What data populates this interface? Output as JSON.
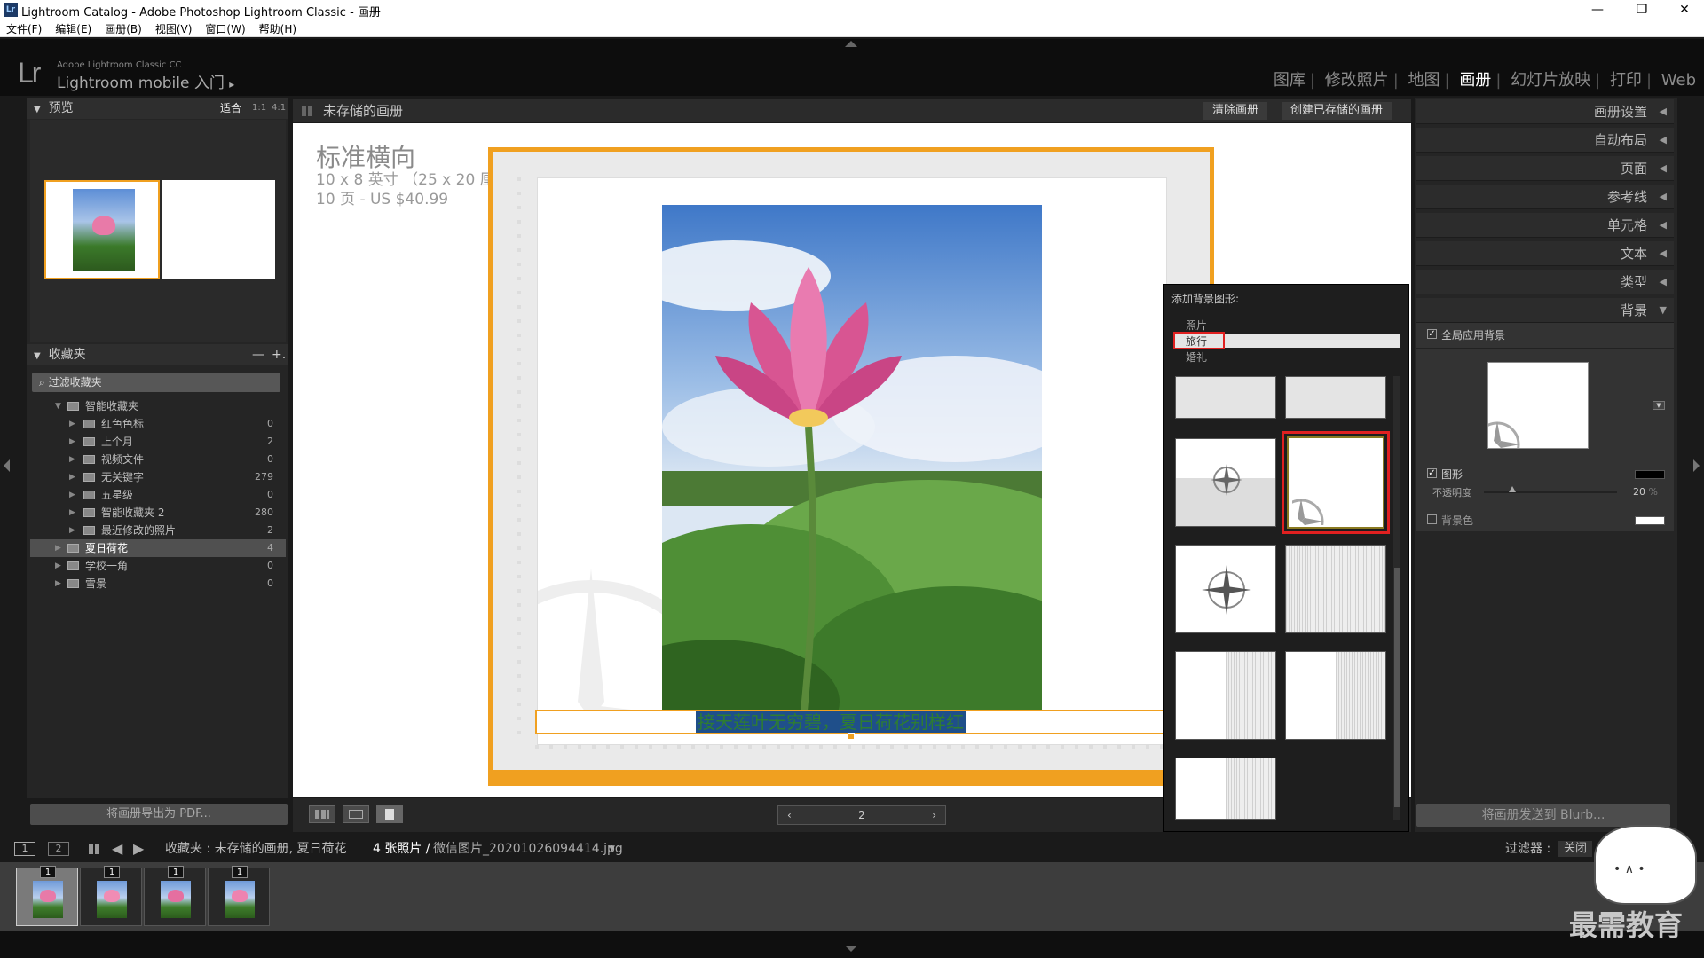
{
  "window": {
    "title": "Lightroom Catalog - Adobe Photoshop Lightroom Classic - 画册",
    "app_icon": "Lr",
    "minimize": "—",
    "restore": "❐",
    "close": "✕"
  },
  "menu": [
    "文件(F)",
    "编辑(E)",
    "画册(B)",
    "视图(V)",
    "窗口(W)",
    "帮助(H)"
  ],
  "identity": {
    "logo": "Lr",
    "small": "Adobe Lightroom Classic CC",
    "big": "Lightroom mobile 入门",
    "arrow": "▸"
  },
  "modules": [
    "图库",
    "修改照片",
    "地图",
    "画册",
    "幻灯片放映",
    "打印",
    "Web"
  ],
  "modules_separator": "|",
  "active_module": "画册",
  "left": {
    "preview_header": "预览",
    "zoom_options": [
      "适合",
      "1:1",
      "4:1"
    ],
    "collections_header": "收藏夹",
    "collections_actions": [
      "—",
      "+."
    ],
    "filter_placeholder": "过滤收藏夹",
    "collections": [
      {
        "name": "智能收藏夹",
        "count": "",
        "level": 0,
        "expanded": true
      },
      {
        "name": "红色色标",
        "count": "0",
        "level": 1
      },
      {
        "name": "上个月",
        "count": "2",
        "level": 1
      },
      {
        "name": "视频文件",
        "count": "0",
        "level": 1
      },
      {
        "name": "无关键字",
        "count": "279",
        "level": 1
      },
      {
        "name": "五星级",
        "count": "0",
        "level": 1
      },
      {
        "name": "智能收藏夹 2",
        "count": "280",
        "level": 1
      },
      {
        "name": "最近修改的照片",
        "count": "2",
        "level": 1
      },
      {
        "name": "夏日荷花",
        "count": "4",
        "level": 0,
        "selected": true
      },
      {
        "name": "学校一角",
        "count": "0",
        "level": 0
      },
      {
        "name": "雪景",
        "count": "0",
        "level": 0
      }
    ],
    "export_button": "将画册导出为 PDF..."
  },
  "center": {
    "header": "未存储的画册",
    "clear_button": "清除画册",
    "create_button": "创建已存储的画册",
    "book_title": "标准横向",
    "book_size": "10 x 8 英寸 （25 x 20 厘米）",
    "book_pages": "10 页 - US $40.99",
    "caption": "接天莲叶无穷碧，夏日荷花别样红",
    "page_number": "2",
    "prev": "‹",
    "next": "›"
  },
  "right": {
    "sections": [
      "画册设置",
      "自动布局",
      "页面",
      "参考线",
      "单元格",
      "文本",
      "类型",
      "背景"
    ],
    "global_bg_label": "全局应用背景",
    "graphic_label": "图形",
    "opacity_label": "不透明度",
    "opacity_value": "20",
    "opacity_unit": "%",
    "bg_color_label": "背景色",
    "send_button": "将画册发送到 Blurb..."
  },
  "popup": {
    "title": "添加背景图形:",
    "categories": [
      "照片",
      "旅行",
      "婚礼"
    ],
    "selected_category": "旅行"
  },
  "filmstrip": {
    "pages": [
      "1",
      "2"
    ],
    "path_prefix": "收藏夹 : 未存储的画册, 夏日荷花",
    "photo_count": "4 张照片 /",
    "filename": "微信图片_20201026094414.jpg",
    "filter_label": "过滤器 :",
    "filter_value": "关闭",
    "badges": [
      "1",
      "1",
      "1",
      "1"
    ]
  },
  "watermark": "最需教育",
  "colors": {
    "accent": "#f0a020",
    "highlight": "#e02020",
    "caption_text": "#2e7d32"
  }
}
